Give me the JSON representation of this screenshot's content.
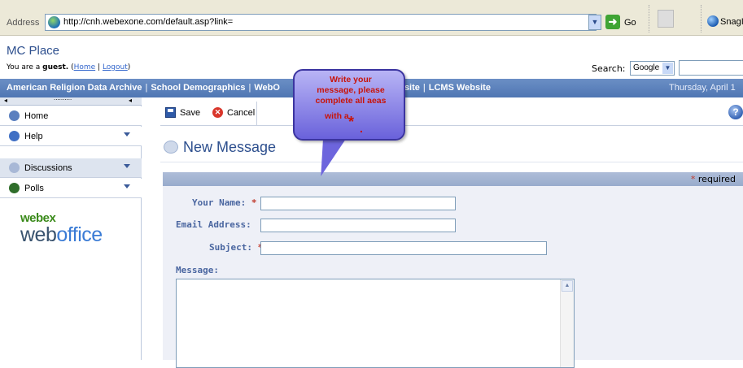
{
  "browser": {
    "address_label": "Address",
    "url": "http://cnh.webexone.com/default.asp?link=",
    "go_label": "Go",
    "snagit_label": "SnagIt"
  },
  "header": {
    "site_title": "MC Place",
    "guest_prefix": "You are a ",
    "guest_word": "guest.",
    "home_link": "Home",
    "logout_link": "Logout",
    "search_label": "Search:",
    "search_engine": "Google"
  },
  "nav": {
    "items": [
      "American Religion Data Archive",
      "School Demographics",
      "WebO",
      "Website",
      "LCMS Website"
    ],
    "date": "Thursday, April 1"
  },
  "sidebar": {
    "items": [
      {
        "label": "Home",
        "icon": "home-icon",
        "color": "#5b7fbf"
      },
      {
        "label": "Help",
        "icon": "help-icon",
        "color": "#3f6fc4"
      },
      {
        "label": "Discussions",
        "icon": "discussions-icon",
        "color": "#a8b8d6"
      },
      {
        "label": "Polls",
        "icon": "polls-icon",
        "color": "#2f6d2a"
      }
    ],
    "logo_top": "webex",
    "logo_bottom_a": "web",
    "logo_bottom_b": "office"
  },
  "toolbar": {
    "save_label": "Save",
    "cancel_label": "Cancel"
  },
  "page": {
    "title": "New Message",
    "required_note": "required"
  },
  "form": {
    "name_label": "Your Name:",
    "email_label": "Email Address:",
    "subject_label": "Subject:",
    "message_label": "Message:",
    "name_value": "",
    "email_value": "",
    "subject_value": "",
    "message_value": ""
  },
  "callout": {
    "line1": "Write your",
    "line2": "message, please",
    "line3": "complete all aeas",
    "line4": "with a"
  }
}
